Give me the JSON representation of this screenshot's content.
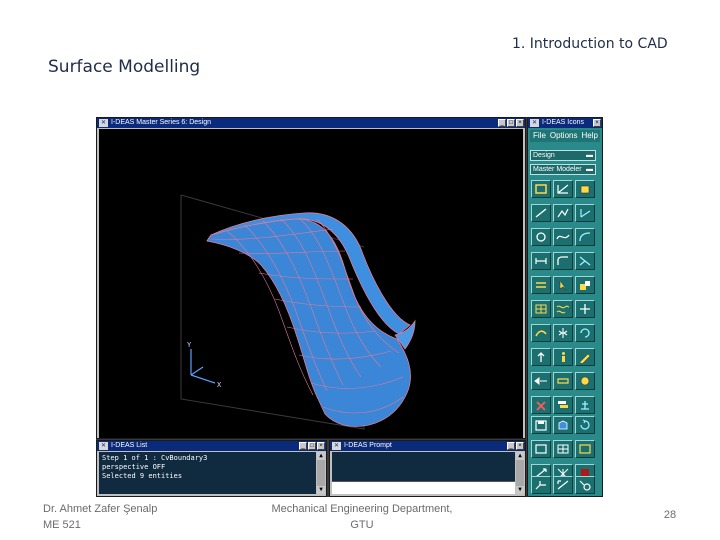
{
  "slide": {
    "section_title": "1. Introduction to CAD",
    "title": "Surface Modelling",
    "footer_author_line1": "Dr. Ahmet Zafer Şenalp",
    "footer_author_line2": "ME 521",
    "footer_dept_line1": "Mechanical Engineering Department,",
    "footer_dept_line2": "GTU",
    "page_number": "28"
  },
  "app": {
    "graphics_window_title": "I-DEAS Master Series 6:   Design",
    "icons_window_title": "I-DEAS Icons",
    "menu": [
      "File",
      "Options",
      "Help"
    ],
    "task": "Design",
    "module": "Master Modeler",
    "list_window_title": "I-DEAS List",
    "list_lines": [
      "Step 1 of 1 : CvBoundary3",
      "perspective OFF",
      "Selected 9 entities"
    ],
    "prompt_window_title": "I-DEAS Prompt",
    "axis_labels": {
      "y": "Y",
      "x": "X"
    },
    "colors": {
      "titlebar": "#0a2a7c",
      "icons_panel": "#2a8a8a",
      "surface": "#3f8fe0",
      "wire": "#e07a9a",
      "viewport": "#000000"
    },
    "tools": [
      "rectangle-tool-icon",
      "dimension-tool-icon",
      "extrude-tool-icon",
      "line-tool-icon",
      "polyline-tool-icon",
      "angle-tool-icon",
      "circle-tool-icon",
      "spline-tool-icon",
      "curve-tool-icon",
      "section-tool-icon",
      "fillet-tool-icon",
      "trim-tool-icon",
      "pattern-tool-icon",
      "pointer-tool-icon",
      "block-tool-icon",
      "grid-tool-icon",
      "wave-tool-icon",
      "move-tool-icon",
      "sweep-tool-icon",
      "mirror-tool-icon",
      "rotate-tool-icon",
      "arrow-tool-icon",
      "info-tool-icon",
      "pencil-tool-icon",
      "view-tool-icon",
      "measure-tool-icon",
      "orbit-tool-icon",
      "delete-tool-icon",
      "stack-tool-icon",
      "tree-tool-icon",
      "save-tool-icon",
      "shade-tool-icon",
      "refresh-tool-icon",
      "display-tool-icon",
      "grid-view-tool-icon",
      "window-tool-icon",
      "zoom-tool-icon",
      "fit-tool-icon",
      "stop-tool-icon",
      "iso-view-tool-icon",
      "pan-tool-icon",
      "select-tool-icon"
    ]
  }
}
